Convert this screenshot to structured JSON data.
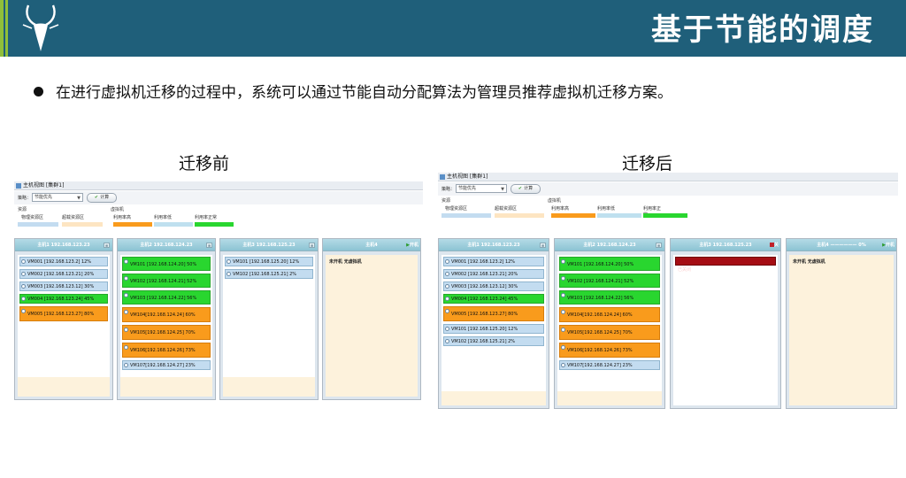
{
  "header": {
    "title": "基于节能的调度",
    "colors": {
      "band": "#1f5f7a",
      "stripe": "#8fbf3a"
    },
    "logo_icon": "antelope-logo-icon"
  },
  "bullet": "在进行虚拟机迁移的过程中，系统可以通过节能自动分配算法为管理员推荐虚拟机迁移方案。",
  "captions": {
    "before": "迁移前",
    "after": "迁移后"
  },
  "shot": {
    "window_title": "主机视图 [集群1]",
    "strategy_label": "策略：",
    "strategy_value": "节能优先",
    "calc_button": "计算",
    "legend": {
      "resource_header": "资源",
      "vm_header": "虚拟机",
      "physical": "物理资源区",
      "overflow": "超载资源区",
      "util_high": "利用率高",
      "util_low": "利用率低",
      "util_normal": "利用率正常",
      "colors": {
        "physical": "#c3dcf0",
        "overflow": "#fde5c2",
        "util_high": "#f99b1c",
        "util_low": "#bfe0ef",
        "util_normal": "#29d62f"
      }
    },
    "no_vm_text": "未开机 无虚拟机",
    "power_on": "开机",
    "power_off": "关"
  },
  "before": {
    "hosts": [
      {
        "title": "主机1 192.168.123.23",
        "vms": [
          {
            "label": "VM001 [192.168.123.2] 12%",
            "color": "blue"
          },
          {
            "label": "VM002 [192.168.123.21] 20%",
            "color": "blue"
          },
          {
            "label": "VM003 [192.168.123.12] 30%",
            "color": "blue"
          },
          {
            "label": "VM004 [192.168.123.24] 45%",
            "color": "green"
          },
          {
            "label": "VM005 [192.168.123.27] 80%",
            "color": "orange"
          }
        ]
      },
      {
        "title": "主机2 192.168.124.23",
        "vms": [
          {
            "label": "VM101 [192.168.124.20] 50%",
            "color": "green"
          },
          {
            "label": "VM102 [192.168.124.21] 52%",
            "color": "green"
          },
          {
            "label": "VM103 [192.168.124.22] 56%",
            "color": "green"
          },
          {
            "label": "VM104[192.168.124.24] 60%",
            "color": "orange"
          },
          {
            "label": "VM105[192.168.124.25] 70%",
            "color": "orange"
          },
          {
            "label": "VM106[192.168.124.26] 73%",
            "color": "orange"
          },
          {
            "label": "VM107[192.168.124.27] 23%",
            "color": "blue"
          }
        ]
      },
      {
        "title": "主机3 192.168.125.23",
        "vms": [
          {
            "label": "VM101 [192.168.125.20] 12%",
            "color": "blue"
          },
          {
            "label": "VM102 [192.168.125.21] 2%",
            "color": "blue"
          }
        ]
      },
      {
        "title": "主机4",
        "off": true
      }
    ]
  },
  "after": {
    "hosts": [
      {
        "title": "主机1 192.168.123.23",
        "vms": [
          {
            "label": "VM001 [192.168.123.2] 12%",
            "color": "blue"
          },
          {
            "label": "VM002 [192.168.123.21] 20%",
            "color": "blue"
          },
          {
            "label": "VM003 [192.168.123.12] 30%",
            "color": "blue"
          },
          {
            "label": "VM004 [192.168.123.24] 45%",
            "color": "green"
          },
          {
            "label": "VM005 [192.168.123.27] 80%",
            "color": "orange"
          },
          {
            "label": "VM101 [192.168.125.20] 12%",
            "color": "blue"
          },
          {
            "label": "VM102 [192.168.125.21] 2%",
            "color": "blue"
          }
        ]
      },
      {
        "title": "主机2 192.168.124.23",
        "vms": [
          {
            "label": "VM101 [192.168.124.20] 50%",
            "color": "green"
          },
          {
            "label": "VM102 [192.168.124.21] 52%",
            "color": "green"
          },
          {
            "label": "VM103 [192.168.124.22] 56%",
            "color": "green"
          },
          {
            "label": "VM104[192.168.124.24] 60%",
            "color": "orange"
          },
          {
            "label": "VM105[192.168.124.25] 70%",
            "color": "orange"
          },
          {
            "label": "VM106[192.168.124.26] 73%",
            "color": "orange"
          },
          {
            "label": "VM107[192.168.124.27] 23%",
            "color": "blue"
          }
        ]
      },
      {
        "title": "主机3 192.168.125.23",
        "alert": "已关闭"
      },
      {
        "title": "主机4",
        "off": true,
        "progress": "0%"
      }
    ]
  }
}
